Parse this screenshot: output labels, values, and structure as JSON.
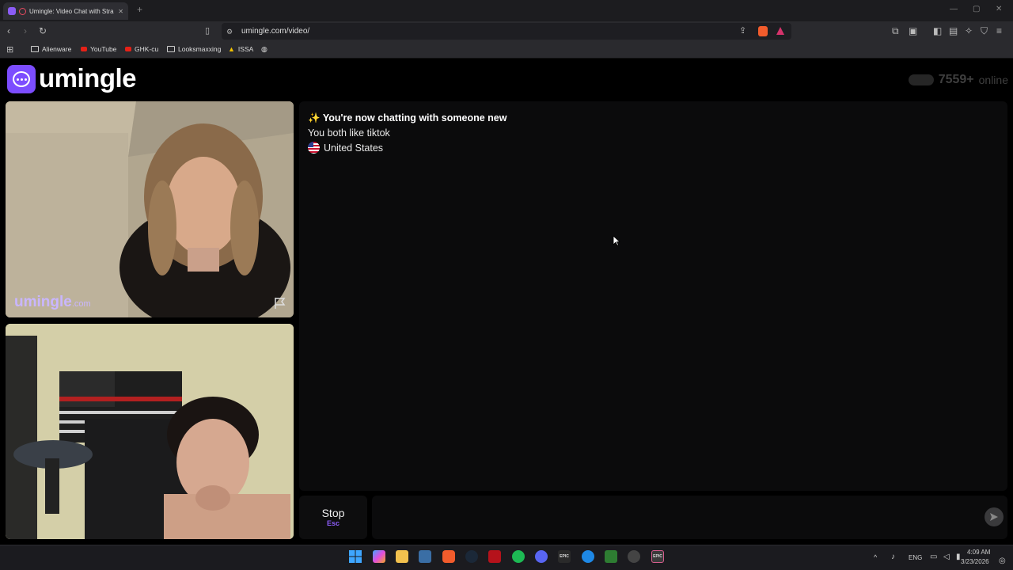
{
  "browser": {
    "tab_title": "Umingle: Video Chat with Stra",
    "new_tab": "+",
    "url": "umingle.com/video/",
    "bookmarks": [
      "Alienware",
      "YouTube",
      "GHK-cu",
      "Looksmaxxing",
      "ISSA"
    ]
  },
  "header": {
    "logo_text": "umingle",
    "online_count": "7559+",
    "online_label": "online"
  },
  "video": {
    "watermark_main": "umingle",
    "watermark_suffix": ".com"
  },
  "chat": {
    "system_icon": "✨",
    "system_message": "You're now chatting with someone new",
    "common_interest": "You both like tiktok",
    "country": "United States",
    "country_flag": "us-flag-icon"
  },
  "controls": {
    "stop_label": "Stop",
    "stop_key": "Esc",
    "message_placeholder": ""
  },
  "taskbar": {
    "language": "ENG",
    "time": "4:09 AM",
    "date": "3/23/2026",
    "epic_label": "EPIC"
  },
  "colors": {
    "brand": "#7c4dff",
    "accent_key": "#8b5cf6"
  }
}
